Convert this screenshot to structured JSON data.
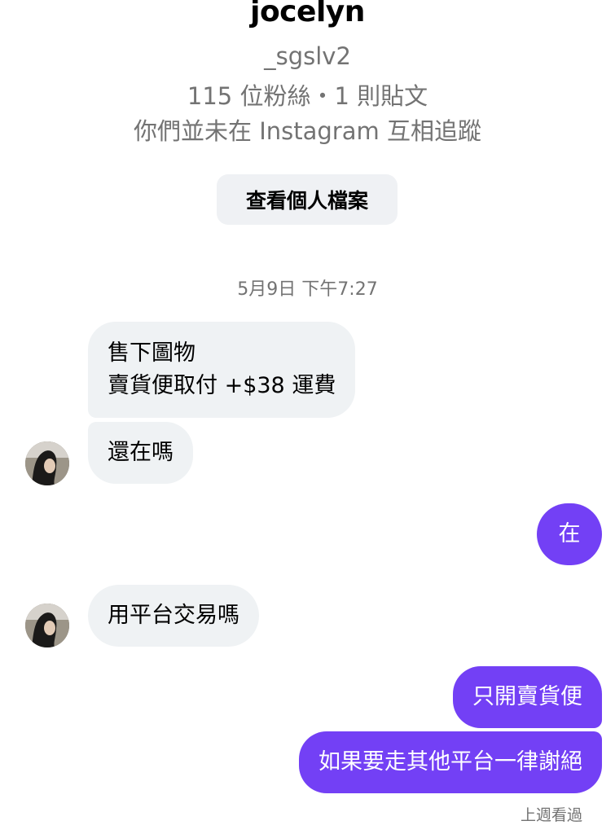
{
  "profile": {
    "display_name": "jocelyn",
    "username": "_sgslv2",
    "stats": "115 位粉絲・1 則貼文",
    "follow_note": "你們並未在 Instagram 互相追蹤",
    "view_profile_label": "查看個人檔案"
  },
  "thread": {
    "timestamp": "5月9日 下午7:27",
    "messages": [
      {
        "from": "them",
        "lines": [
          "售下圖物",
          "賣貨便取付 +$38 運費"
        ]
      },
      {
        "from": "them",
        "lines": [
          "還在嗎"
        ]
      },
      {
        "from": "me",
        "lines": [
          "在"
        ]
      },
      {
        "from": "them",
        "lines": [
          "用平台交易嗎"
        ]
      },
      {
        "from": "me",
        "lines": [
          "只開賣貨便"
        ]
      },
      {
        "from": "me",
        "lines": [
          "如果要走其他平台一律謝絕"
        ]
      }
    ],
    "seen_status": "上週看過"
  },
  "colors": {
    "outgoing_bubble": "#7340f5",
    "incoming_bubble": "#eff2f4",
    "secondary_text": "#737373"
  },
  "icons": {
    "avatar": "profile-photo"
  }
}
